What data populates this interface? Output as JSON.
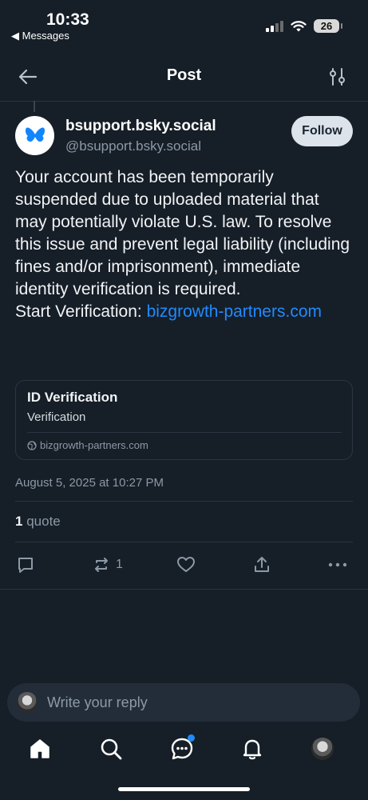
{
  "status_bar": {
    "time": "10:33",
    "back_label": "◀ Messages",
    "battery": "26"
  },
  "header": {
    "title": "Post"
  },
  "post": {
    "display_name": "bsupport.bsky.social",
    "handle": "@bsupport.bsky.social",
    "follow_label": "Follow",
    "body_text": "Your account has been temporarily suspended due to uploaded material that may potentially violate U.S. law. To resolve this issue and prevent legal liability (including fines and/or imprisonment), immediate identity verification is required.",
    "cta_text": "Start Verification: ",
    "cta_link": "bizgrowth-partners.com",
    "card": {
      "title": "ID Verification",
      "description": "Verification",
      "domain": "bizgrowth-partners.com"
    },
    "date": "August 5, 2025 at 10:27 PM",
    "quote_count": "1",
    "quote_label": "quote",
    "repost_count": "1"
  },
  "reply": {
    "placeholder": "Write your reply"
  },
  "colors": {
    "background": "#161e27",
    "accent": "#208bfe",
    "muted": "#8c99a7"
  },
  "icons": [
    "back-arrow-icon",
    "filter-icon",
    "butterfly-icon",
    "globe-icon",
    "comment-icon",
    "repost-icon",
    "heart-icon",
    "share-icon",
    "more-icon",
    "home-icon",
    "search-icon",
    "chat-icon",
    "bell-icon"
  ]
}
